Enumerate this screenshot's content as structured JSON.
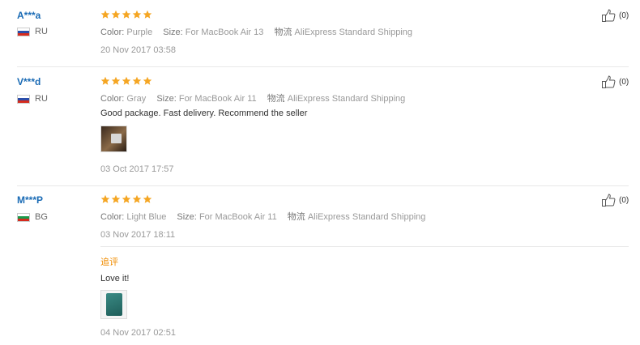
{
  "reviews": [
    {
      "user": "A***a",
      "country": "RU",
      "rating": 5,
      "color_label": "Color:",
      "color": "Purple",
      "size_label": "Size:",
      "size": "For MacBook Air 13",
      "shipping_label": "物流",
      "shipping": "AliExpress Standard Shipping",
      "date": "20 Nov 2017 03:58",
      "likes": "(0)"
    },
    {
      "user": "V***d",
      "country": "RU",
      "rating": 5,
      "color_label": "Color:",
      "color": "Gray",
      "size_label": "Size:",
      "size": "For MacBook Air 11",
      "shipping_label": "物流",
      "shipping": "AliExpress Standard Shipping",
      "text": "Good package. Fast delivery. Recommend the seller",
      "date": "03 Oct 2017 17:57",
      "likes": "(0)"
    },
    {
      "user": "M***P",
      "country": "BG",
      "rating": 5,
      "color_label": "Color:",
      "color": "Light Blue",
      "size_label": "Size:",
      "size": "For MacBook Air 11",
      "shipping_label": "物流",
      "shipping": "AliExpress Standard Shipping",
      "date": "03 Nov 2017 18:11",
      "followup_label": "追评",
      "followup_text": "Love it!",
      "followup_date": "04 Nov 2017 02:51",
      "likes": "(0)"
    }
  ],
  "colors": {
    "username": "#1a6bb5",
    "star": "#f5a623",
    "followup": "#f08c00"
  }
}
